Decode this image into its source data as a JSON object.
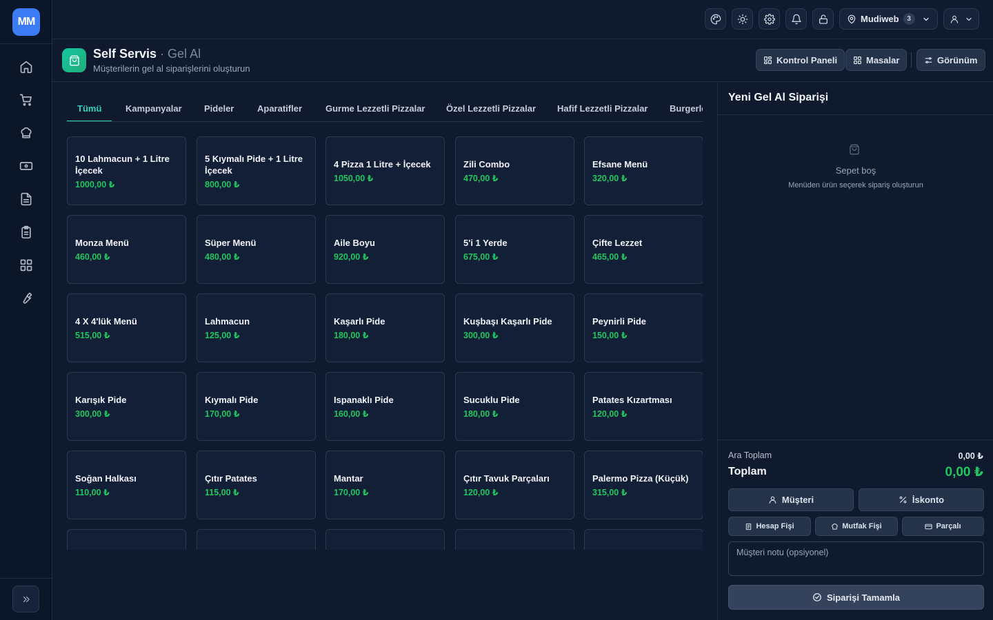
{
  "brand": {
    "logo_text": "MM"
  },
  "sidebar": {
    "items": [
      {
        "name": "home-icon"
      },
      {
        "name": "cart-icon"
      },
      {
        "name": "chef-hat-icon"
      },
      {
        "name": "banknote-icon"
      },
      {
        "name": "document-icon"
      },
      {
        "name": "clipboard-icon"
      },
      {
        "name": "grid-icon"
      },
      {
        "name": "wrench-icon"
      }
    ],
    "expand_icon": "chevrons-right-icon"
  },
  "topbar": {
    "icons": [
      "palette-icon",
      "sun-icon",
      "gear-icon",
      "bell-icon",
      "lock-icon"
    ],
    "branch_name": "Mudiweb",
    "branch_count": "3"
  },
  "header": {
    "title": "Self Servis",
    "subtitle": " · Gel Al",
    "description": "Müşterilerin gel al siparişlerini oluşturun",
    "buttons": {
      "dashboard": "Kontrol Paneli",
      "tables": "Masalar",
      "view": "Görünüm"
    }
  },
  "tabs": [
    "Tümü",
    "Kampanyalar",
    "Pideler",
    "Aparatifler",
    "Gurme Lezzetli Pizzalar",
    "Özel Lezzetli Pizzalar",
    "Hafif Lezzetli Pizzalar",
    "Burgerle"
  ],
  "active_tab": "Tümü",
  "products": [
    {
      "name": "10 Lahmacun + 1 Litre İçecek",
      "price": "1000,00 ₺"
    },
    {
      "name": "5 Kıymalı Pide + 1 Litre İçecek",
      "price": "800,00 ₺"
    },
    {
      "name": "4 Pizza 1 Litre + İçecek",
      "price": "1050,00 ₺"
    },
    {
      "name": "Zili Combo",
      "price": "470,00 ₺"
    },
    {
      "name": "Efsane Menü",
      "price": "320,00 ₺"
    },
    {
      "name": "Monza Menü",
      "price": "460,00 ₺"
    },
    {
      "name": "Süper Menü",
      "price": "480,00 ₺"
    },
    {
      "name": "Aile Boyu",
      "price": "920,00 ₺"
    },
    {
      "name": "5'i 1 Yerde",
      "price": "675,00 ₺"
    },
    {
      "name": "Çifte Lezzet",
      "price": "465,00 ₺"
    },
    {
      "name": "4 X 4'lük Menü",
      "price": "515,00 ₺"
    },
    {
      "name": "Lahmacun",
      "price": "125,00 ₺"
    },
    {
      "name": "Kaşarlı Pide",
      "price": "180,00 ₺"
    },
    {
      "name": "Kuşbaşı Kaşarlı Pide",
      "price": "300,00 ₺"
    },
    {
      "name": "Peynirli Pide",
      "price": "150,00 ₺"
    },
    {
      "name": "Karışık Pide",
      "price": "300,00 ₺"
    },
    {
      "name": "Kıymalı Pide",
      "price": "170,00 ₺"
    },
    {
      "name": "Ispanaklı Pide",
      "price": "160,00 ₺"
    },
    {
      "name": "Sucuklu Pide",
      "price": "180,00 ₺"
    },
    {
      "name": "Patates Kızartması",
      "price": "120,00 ₺"
    },
    {
      "name": "Soğan Halkası",
      "price": "110,00 ₺"
    },
    {
      "name": "Çıtır Patates",
      "price": "115,00 ₺"
    },
    {
      "name": "Mantar",
      "price": "170,00 ₺"
    },
    {
      "name": "Çıtır Tavuk Parçaları",
      "price": "120,00 ₺"
    },
    {
      "name": "Palermo Pizza (Küçük)",
      "price": "315,00 ₺"
    },
    {
      "name": "",
      "price": ""
    },
    {
      "name": "",
      "price": ""
    },
    {
      "name": "",
      "price": ""
    },
    {
      "name": "",
      "price": ""
    },
    {
      "name": "",
      "price": ""
    }
  ],
  "order": {
    "title": "Yeni Gel Al Siparişi",
    "empty_title": "Sepet boş",
    "empty_desc": "Menüden ürün seçerek sipariş oluşturun",
    "subtotal_label": "Ara Toplam",
    "subtotal": "0,00 ₺",
    "total_label": "Toplam",
    "total": "0,00 ₺",
    "customer_button": "Müşteri",
    "discount_button": "İskonto",
    "bill_button": "Hesap Fişi",
    "kitchen_button": "Mutfak Fişi",
    "split_button": "Parçalı",
    "note_placeholder": "Müşteri notu (opsiyonel)",
    "complete_button": "Siparişi Tamamla"
  },
  "colors": {
    "accent": "#3b7bf6",
    "price": "#22c55e",
    "active_tab": "#2dd4bf",
    "background": "#0f1a2e"
  }
}
